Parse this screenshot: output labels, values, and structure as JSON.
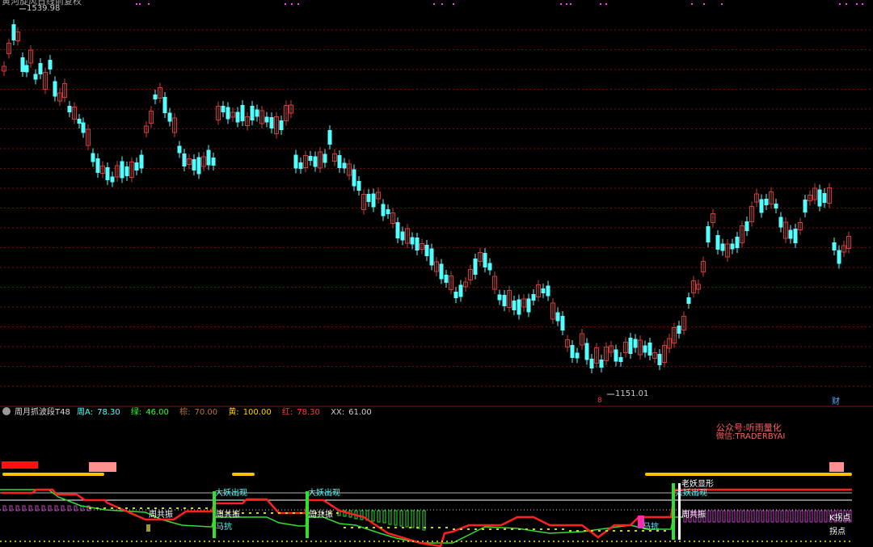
{
  "header": {
    "title": "黄河旋风日线前复权",
    "last_price": "1539.98"
  },
  "price_chart": {
    "high_label": "1539.98",
    "low_label": "1151.01",
    "low_marker": "8",
    "fin_marker": "财",
    "up_color": "#d23a3a",
    "down_color": "#54ffff",
    "grid_color": "#7a0a0a"
  },
  "indicator": {
    "name": "周月抓波段T48",
    "params": [
      {
        "label": "周A:",
        "value": "78.30",
        "color": "#54ffff"
      },
      {
        "label": "绿:",
        "value": "46.00",
        "color": "#2dff2d"
      },
      {
        "label": "棕:",
        "value": "70.00",
        "color": "#bb7a2a"
      },
      {
        "label": "黄:",
        "value": "100.00",
        "color": "#ffd000"
      },
      {
        "label": "红:",
        "value": "78.30",
        "color": "#ff3c3c"
      },
      {
        "label": "XX:",
        "value": "61.00",
        "color": "#cfcfcf"
      }
    ]
  },
  "watermark": {
    "line1": "公众号:听雨量化",
    "line2": "微信:TRADERBYAI"
  },
  "signals": {
    "dayao": "大妖出现",
    "zhougongzhen": "周共振",
    "mapao": "马抗",
    "laoyao": "老妖显形",
    "kdian": "K拐点",
    "guaidian": "拐点"
  }
}
